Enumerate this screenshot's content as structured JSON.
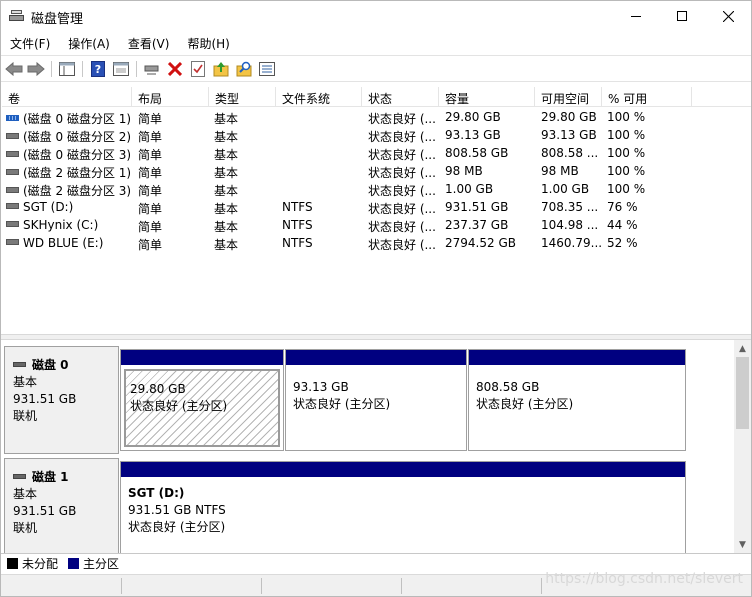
{
  "window": {
    "title": "磁盘管理"
  },
  "menu": [
    "文件(F)",
    "操作(A)",
    "查看(V)",
    "帮助(H)"
  ],
  "toolbar": {
    "icons": [
      "back-arrow-icon",
      "forward-arrow-icon",
      "console-tree-icon",
      "help-icon",
      "properties-icon",
      "connect-icon",
      "delete-icon",
      "check-icon",
      "up-folder-icon",
      "search-icon",
      "view-icon"
    ]
  },
  "table": {
    "columns": [
      "卷",
      "布局",
      "类型",
      "文件系统",
      "状态",
      "容量",
      "可用空间",
      "% 可用"
    ],
    "rows": [
      {
        "volume": "(磁盘 0 磁盘分区 1)",
        "layout": "简单",
        "type": "基本",
        "fs": "",
        "status": "状态良好 (...",
        "capacity": "29.80 GB",
        "free": "29.80 GB",
        "pct": "100 %",
        "icon": "striped"
      },
      {
        "volume": "(磁盘 0 磁盘分区 2)",
        "layout": "简单",
        "type": "基本",
        "fs": "",
        "status": "状态良好 (...",
        "capacity": "93.13 GB",
        "free": "93.13 GB",
        "pct": "100 %",
        "icon": "plain"
      },
      {
        "volume": "(磁盘 0 磁盘分区 3)",
        "layout": "简单",
        "type": "基本",
        "fs": "",
        "status": "状态良好 (...",
        "capacity": "808.58 GB",
        "free": "808.58 ...",
        "pct": "100 %",
        "icon": "plain"
      },
      {
        "volume": "(磁盘 2 磁盘分区 1)",
        "layout": "简单",
        "type": "基本",
        "fs": "",
        "status": "状态良好 (...",
        "capacity": "98 MB",
        "free": "98 MB",
        "pct": "100 %",
        "icon": "plain"
      },
      {
        "volume": "(磁盘 2 磁盘分区 3)",
        "layout": "简单",
        "type": "基本",
        "fs": "",
        "status": "状态良好 (...",
        "capacity": "1.00 GB",
        "free": "1.00 GB",
        "pct": "100 %",
        "icon": "plain"
      },
      {
        "volume": "SGT (D:)",
        "layout": "简单",
        "type": "基本",
        "fs": "NTFS",
        "status": "状态良好 (...",
        "capacity": "931.51 GB",
        "free": "708.35 ...",
        "pct": "76 %",
        "icon": "plain"
      },
      {
        "volume": "SKHynix (C:)",
        "layout": "简单",
        "type": "基本",
        "fs": "NTFS",
        "status": "状态良好 (...",
        "capacity": "237.37 GB",
        "free": "104.98 ...",
        "pct": "44 %",
        "icon": "plain"
      },
      {
        "volume": "WD BLUE (E:)",
        "layout": "简单",
        "type": "基本",
        "fs": "NTFS",
        "status": "状态良好 (...",
        "capacity": "2794.52 GB",
        "free": "1460.79...",
        "pct": "52 %",
        "icon": "plain"
      }
    ]
  },
  "disks": [
    {
      "name": "磁盘 0",
      "kind": "基本",
      "size": "931.51 GB",
      "state": "联机",
      "partitions": [
        {
          "title": "",
          "line1": "29.80 GB",
          "line2": "状态良好 (主分区)",
          "hatched": true
        },
        {
          "title": "",
          "line1": "93.13 GB",
          "line2": "状态良好 (主分区)",
          "hatched": false
        },
        {
          "title": "",
          "line1": "808.58 GB",
          "line2": "状态良好 (主分区)",
          "hatched": false
        }
      ]
    },
    {
      "name": "磁盘 1",
      "kind": "基本",
      "size": "931.51 GB",
      "state": "联机",
      "partitions": [
        {
          "title": "SGT  (D:)",
          "line1": "931.51 GB NTFS",
          "line2": "状态良好 (主分区)",
          "hatched": false
        }
      ]
    }
  ],
  "legend": [
    {
      "label": "未分配",
      "color": "#000000"
    },
    {
      "label": "主分区",
      "color": "#000080"
    }
  ],
  "watermark": "https://blog.csdn.net/slevert"
}
